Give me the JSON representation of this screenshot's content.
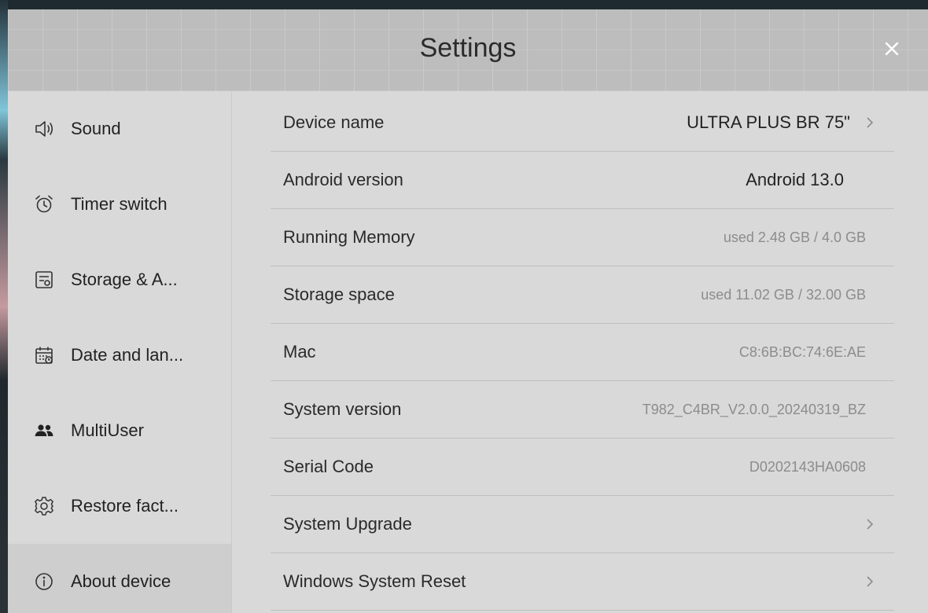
{
  "window": {
    "title": "Settings"
  },
  "sidebar": {
    "items": [
      {
        "label": "Sound",
        "icon": "speaker-icon"
      },
      {
        "label": "Timer switch",
        "icon": "alarm-clock-icon"
      },
      {
        "label": "Storage & A...",
        "icon": "storage-icon"
      },
      {
        "label": "Date and lan...",
        "icon": "calendar-icon"
      },
      {
        "label": "MultiUser",
        "icon": "users-icon"
      },
      {
        "label": "Restore fact...",
        "icon": "gear-icon"
      },
      {
        "label": "About device",
        "icon": "info-icon",
        "selected": true
      }
    ]
  },
  "about": {
    "rows": [
      {
        "label": "Device name",
        "value": "ULTRA PLUS BR 75\"",
        "chevron": true
      },
      {
        "label": "Android version",
        "value": "Android 13.0"
      },
      {
        "label": "Running Memory",
        "value": "used 2.48 GB / 4.0 GB"
      },
      {
        "label": "Storage space",
        "value": "used 11.02 GB / 32.00 GB"
      },
      {
        "label": "Mac",
        "value": "C8:6B:BC:74:6E:AE"
      },
      {
        "label": "System version",
        "value": "T982_C4BR_V2.0.0_20240319_BZ"
      },
      {
        "label": "Serial Code",
        "value": "D0202143HA0608"
      },
      {
        "label": "System Upgrade",
        "chevron": true
      },
      {
        "label": "Windows System Reset",
        "chevron": true
      }
    ]
  }
}
